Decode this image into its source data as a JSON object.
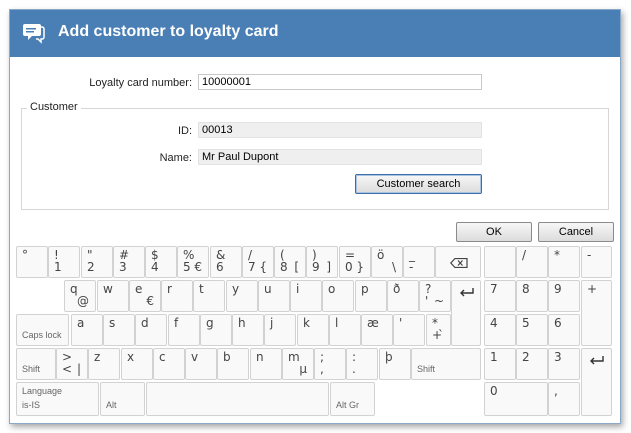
{
  "dialog": {
    "title": "Add customer to loyalty card",
    "icon": "chat-bubble-icon"
  },
  "form": {
    "loyalty_card_label": "Loyalty card number:",
    "loyalty_card_value": "10000001",
    "customer_legend": "Customer",
    "id_label": "ID:",
    "id_value": "00013",
    "name_label": "Name:",
    "name_value": "Mr Paul Dupont",
    "customer_search_label": "Customer search"
  },
  "buttons": {
    "ok": "OK",
    "cancel": "Cancel"
  },
  "keyboard": {
    "keys": [
      {
        "id": "k-degree",
        "tl": "°",
        "bl": "",
        "br": ""
      },
      {
        "id": "k-1",
        "tl": "!",
        "bl": "1",
        "br": ""
      },
      {
        "id": "k-2",
        "tl": "\"",
        "bl": "2",
        "br": ""
      },
      {
        "id": "k-3",
        "tl": "#",
        "bl": "3",
        "br": ""
      },
      {
        "id": "k-4",
        "tl": "$",
        "bl": "4",
        "br": ""
      },
      {
        "id": "k-5",
        "tl": "%",
        "bl": "5",
        "br": "€"
      },
      {
        "id": "k-6",
        "tl": "&",
        "bl": "6",
        "br": ""
      },
      {
        "id": "k-7",
        "tl": "/",
        "bl": "7",
        "br": "{"
      },
      {
        "id": "k-8",
        "tl": "(",
        "bl": "8",
        "br": "["
      },
      {
        "id": "k-9",
        "tl": ")",
        "bl": "9",
        "br": "]"
      },
      {
        "id": "k-0",
        "tl": "=",
        "bl": "0",
        "br": "}"
      },
      {
        "id": "k-odiaeresis",
        "tl": "ö",
        "bl": "",
        "br": "\\"
      },
      {
        "id": "k-minus",
        "tl": "_",
        "bl": "-",
        "br": ""
      },
      {
        "id": "k-backspace",
        "tl": "",
        "bl": "",
        "br": ""
      },
      {
        "id": "k-q",
        "tl": "q",
        "bl": "",
        "br": "@"
      },
      {
        "id": "k-w",
        "tl": "w",
        "bl": "",
        "br": ""
      },
      {
        "id": "k-e",
        "tl": "e",
        "bl": "",
        "br": "€"
      },
      {
        "id": "k-r",
        "tl": "r",
        "bl": "",
        "br": ""
      },
      {
        "id": "k-t",
        "tl": "t",
        "bl": "",
        "br": ""
      },
      {
        "id": "k-y",
        "tl": "y",
        "bl": "",
        "br": ""
      },
      {
        "id": "k-u",
        "tl": "u",
        "bl": "",
        "br": ""
      },
      {
        "id": "k-i",
        "tl": "i",
        "bl": "",
        "br": ""
      },
      {
        "id": "k-o",
        "tl": "o",
        "bl": "",
        "br": ""
      },
      {
        "id": "k-p",
        "tl": "p",
        "bl": "",
        "br": ""
      },
      {
        "id": "k-eth",
        "tl": "ð",
        "bl": "",
        "br": ""
      },
      {
        "id": "k-question",
        "tl": "?",
        "bl": "'",
        "br": "~"
      },
      {
        "id": "k-enter-main",
        "tl": "",
        "bl": "",
        "br": ""
      },
      {
        "id": "k-capslock",
        "tl": "",
        "bl": "Caps lock",
        "br": ""
      },
      {
        "id": "k-a",
        "tl": "a",
        "bl": "",
        "br": ""
      },
      {
        "id": "k-s",
        "tl": "s",
        "bl": "",
        "br": ""
      },
      {
        "id": "k-d",
        "tl": "d",
        "bl": "",
        "br": ""
      },
      {
        "id": "k-f",
        "tl": "f",
        "bl": "",
        "br": ""
      },
      {
        "id": "k-g",
        "tl": "g",
        "bl": "",
        "br": ""
      },
      {
        "id": "k-h",
        "tl": "h",
        "bl": "",
        "br": ""
      },
      {
        "id": "k-j",
        "tl": "j",
        "bl": "",
        "br": ""
      },
      {
        "id": "k-k",
        "tl": "k",
        "bl": "",
        "br": ""
      },
      {
        "id": "k-l",
        "tl": "l",
        "bl": "",
        "br": ""
      },
      {
        "id": "k-ae",
        "tl": "æ",
        "bl": "",
        "br": ""
      },
      {
        "id": "k-acute",
        "tl": "'",
        "bl": "",
        "br": ""
      },
      {
        "id": "k-plus",
        "tl": "*",
        "bl": "+",
        "br": "`"
      },
      {
        "id": "k-shift-left",
        "tl": "",
        "bl": "Shift",
        "br": ""
      },
      {
        "id": "k-less",
        "tl": ">",
        "bl": "<",
        "br": "|"
      },
      {
        "id": "k-z",
        "tl": "z",
        "bl": "",
        "br": ""
      },
      {
        "id": "k-x",
        "tl": "x",
        "bl": "",
        "br": ""
      },
      {
        "id": "k-c",
        "tl": "c",
        "bl": "",
        "br": ""
      },
      {
        "id": "k-v",
        "tl": "v",
        "bl": "",
        "br": ""
      },
      {
        "id": "k-b",
        "tl": "b",
        "bl": "",
        "br": ""
      },
      {
        "id": "k-n",
        "tl": "n",
        "bl": "",
        "br": ""
      },
      {
        "id": "k-m",
        "tl": "m",
        "bl": "",
        "br": "µ"
      },
      {
        "id": "k-comma",
        "tl": ";",
        "bl": ",",
        "br": ""
      },
      {
        "id": "k-period",
        "tl": ":",
        "bl": ".",
        "br": ""
      },
      {
        "id": "k-thorn",
        "tl": "þ",
        "bl": "",
        "br": ""
      },
      {
        "id": "k-shift-right",
        "tl": "",
        "bl": "Shift",
        "br": ""
      },
      {
        "id": "k-language",
        "tl": "Language",
        "bl": "is-IS",
        "br": ""
      },
      {
        "id": "k-alt",
        "tl": "",
        "bl": "Alt",
        "br": ""
      },
      {
        "id": "k-space",
        "tl": "",
        "bl": "",
        "br": ""
      },
      {
        "id": "k-altgr",
        "tl": "",
        "bl": "Alt Gr",
        "br": ""
      },
      {
        "id": "k-num-blank",
        "tl": "",
        "bl": "",
        "br": ""
      },
      {
        "id": "k-num-slash",
        "tl": "/",
        "bl": "",
        "br": ""
      },
      {
        "id": "k-num-star",
        "tl": "*",
        "bl": "",
        "br": ""
      },
      {
        "id": "k-num-minus",
        "tl": "-",
        "bl": "",
        "br": ""
      },
      {
        "id": "k-num-7",
        "tl": "7",
        "bl": "",
        "br": ""
      },
      {
        "id": "k-num-8",
        "tl": "8",
        "bl": "",
        "br": ""
      },
      {
        "id": "k-num-9",
        "tl": "9",
        "bl": "",
        "br": ""
      },
      {
        "id": "k-num-plus",
        "tl": "+",
        "bl": "",
        "br": ""
      },
      {
        "id": "k-num-4",
        "tl": "4",
        "bl": "",
        "br": ""
      },
      {
        "id": "k-num-5",
        "tl": "5",
        "bl": "",
        "br": ""
      },
      {
        "id": "k-num-6",
        "tl": "6",
        "bl": "",
        "br": ""
      },
      {
        "id": "k-num-1",
        "tl": "1",
        "bl": "",
        "br": ""
      },
      {
        "id": "k-num-2",
        "tl": "2",
        "bl": "",
        "br": ""
      },
      {
        "id": "k-num-3",
        "tl": "3",
        "bl": "",
        "br": ""
      },
      {
        "id": "k-num-enter",
        "tl": "",
        "bl": "",
        "br": ""
      },
      {
        "id": "k-num-0",
        "tl": "0",
        "bl": "",
        "br": ""
      },
      {
        "id": "k-num-comma",
        "tl": ",",
        "bl": "",
        "br": ""
      }
    ]
  },
  "colors": {
    "titlebar": "#4a7fb5",
    "title_text": "#ffffff"
  }
}
